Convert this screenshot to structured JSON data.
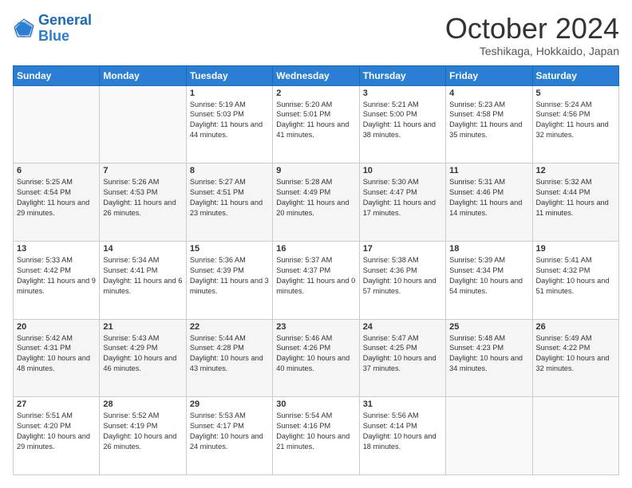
{
  "logo": {
    "line1": "General",
    "line2": "Blue"
  },
  "title": "October 2024",
  "location": "Teshikaga, Hokkaido, Japan",
  "days_of_week": [
    "Sunday",
    "Monday",
    "Tuesday",
    "Wednesday",
    "Thursday",
    "Friday",
    "Saturday"
  ],
  "weeks": [
    [
      {
        "day": "",
        "content": ""
      },
      {
        "day": "",
        "content": ""
      },
      {
        "day": "1",
        "sunrise": "Sunrise: 5:19 AM",
        "sunset": "Sunset: 5:03 PM",
        "daylight": "Daylight: 11 hours and 44 minutes."
      },
      {
        "day": "2",
        "sunrise": "Sunrise: 5:20 AM",
        "sunset": "Sunset: 5:01 PM",
        "daylight": "Daylight: 11 hours and 41 minutes."
      },
      {
        "day": "3",
        "sunrise": "Sunrise: 5:21 AM",
        "sunset": "Sunset: 5:00 PM",
        "daylight": "Daylight: 11 hours and 38 minutes."
      },
      {
        "day": "4",
        "sunrise": "Sunrise: 5:23 AM",
        "sunset": "Sunset: 4:58 PM",
        "daylight": "Daylight: 11 hours and 35 minutes."
      },
      {
        "day": "5",
        "sunrise": "Sunrise: 5:24 AM",
        "sunset": "Sunset: 4:56 PM",
        "daylight": "Daylight: 11 hours and 32 minutes."
      }
    ],
    [
      {
        "day": "6",
        "sunrise": "Sunrise: 5:25 AM",
        "sunset": "Sunset: 4:54 PM",
        "daylight": "Daylight: 11 hours and 29 minutes."
      },
      {
        "day": "7",
        "sunrise": "Sunrise: 5:26 AM",
        "sunset": "Sunset: 4:53 PM",
        "daylight": "Daylight: 11 hours and 26 minutes."
      },
      {
        "day": "8",
        "sunrise": "Sunrise: 5:27 AM",
        "sunset": "Sunset: 4:51 PM",
        "daylight": "Daylight: 11 hours and 23 minutes."
      },
      {
        "day": "9",
        "sunrise": "Sunrise: 5:28 AM",
        "sunset": "Sunset: 4:49 PM",
        "daylight": "Daylight: 11 hours and 20 minutes."
      },
      {
        "day": "10",
        "sunrise": "Sunrise: 5:30 AM",
        "sunset": "Sunset: 4:47 PM",
        "daylight": "Daylight: 11 hours and 17 minutes."
      },
      {
        "day": "11",
        "sunrise": "Sunrise: 5:31 AM",
        "sunset": "Sunset: 4:46 PM",
        "daylight": "Daylight: 11 hours and 14 minutes."
      },
      {
        "day": "12",
        "sunrise": "Sunrise: 5:32 AM",
        "sunset": "Sunset: 4:44 PM",
        "daylight": "Daylight: 11 hours and 11 minutes."
      }
    ],
    [
      {
        "day": "13",
        "sunrise": "Sunrise: 5:33 AM",
        "sunset": "Sunset: 4:42 PM",
        "daylight": "Daylight: 11 hours and 9 minutes."
      },
      {
        "day": "14",
        "sunrise": "Sunrise: 5:34 AM",
        "sunset": "Sunset: 4:41 PM",
        "daylight": "Daylight: 11 hours and 6 minutes."
      },
      {
        "day": "15",
        "sunrise": "Sunrise: 5:36 AM",
        "sunset": "Sunset: 4:39 PM",
        "daylight": "Daylight: 11 hours and 3 minutes."
      },
      {
        "day": "16",
        "sunrise": "Sunrise: 5:37 AM",
        "sunset": "Sunset: 4:37 PM",
        "daylight": "Daylight: 11 hours and 0 minutes."
      },
      {
        "day": "17",
        "sunrise": "Sunrise: 5:38 AM",
        "sunset": "Sunset: 4:36 PM",
        "daylight": "Daylight: 10 hours and 57 minutes."
      },
      {
        "day": "18",
        "sunrise": "Sunrise: 5:39 AM",
        "sunset": "Sunset: 4:34 PM",
        "daylight": "Daylight: 10 hours and 54 minutes."
      },
      {
        "day": "19",
        "sunrise": "Sunrise: 5:41 AM",
        "sunset": "Sunset: 4:32 PM",
        "daylight": "Daylight: 10 hours and 51 minutes."
      }
    ],
    [
      {
        "day": "20",
        "sunrise": "Sunrise: 5:42 AM",
        "sunset": "Sunset: 4:31 PM",
        "daylight": "Daylight: 10 hours and 48 minutes."
      },
      {
        "day": "21",
        "sunrise": "Sunrise: 5:43 AM",
        "sunset": "Sunset: 4:29 PM",
        "daylight": "Daylight: 10 hours and 46 minutes."
      },
      {
        "day": "22",
        "sunrise": "Sunrise: 5:44 AM",
        "sunset": "Sunset: 4:28 PM",
        "daylight": "Daylight: 10 hours and 43 minutes."
      },
      {
        "day": "23",
        "sunrise": "Sunrise: 5:46 AM",
        "sunset": "Sunset: 4:26 PM",
        "daylight": "Daylight: 10 hours and 40 minutes."
      },
      {
        "day": "24",
        "sunrise": "Sunrise: 5:47 AM",
        "sunset": "Sunset: 4:25 PM",
        "daylight": "Daylight: 10 hours and 37 minutes."
      },
      {
        "day": "25",
        "sunrise": "Sunrise: 5:48 AM",
        "sunset": "Sunset: 4:23 PM",
        "daylight": "Daylight: 10 hours and 34 minutes."
      },
      {
        "day": "26",
        "sunrise": "Sunrise: 5:49 AM",
        "sunset": "Sunset: 4:22 PM",
        "daylight": "Daylight: 10 hours and 32 minutes."
      }
    ],
    [
      {
        "day": "27",
        "sunrise": "Sunrise: 5:51 AM",
        "sunset": "Sunset: 4:20 PM",
        "daylight": "Daylight: 10 hours and 29 minutes."
      },
      {
        "day": "28",
        "sunrise": "Sunrise: 5:52 AM",
        "sunset": "Sunset: 4:19 PM",
        "daylight": "Daylight: 10 hours and 26 minutes."
      },
      {
        "day": "29",
        "sunrise": "Sunrise: 5:53 AM",
        "sunset": "Sunset: 4:17 PM",
        "daylight": "Daylight: 10 hours and 24 minutes."
      },
      {
        "day": "30",
        "sunrise": "Sunrise: 5:54 AM",
        "sunset": "Sunset: 4:16 PM",
        "daylight": "Daylight: 10 hours and 21 minutes."
      },
      {
        "day": "31",
        "sunrise": "Sunrise: 5:56 AM",
        "sunset": "Sunset: 4:14 PM",
        "daylight": "Daylight: 10 hours and 18 minutes."
      },
      {
        "day": "",
        "content": ""
      },
      {
        "day": "",
        "content": ""
      }
    ]
  ]
}
